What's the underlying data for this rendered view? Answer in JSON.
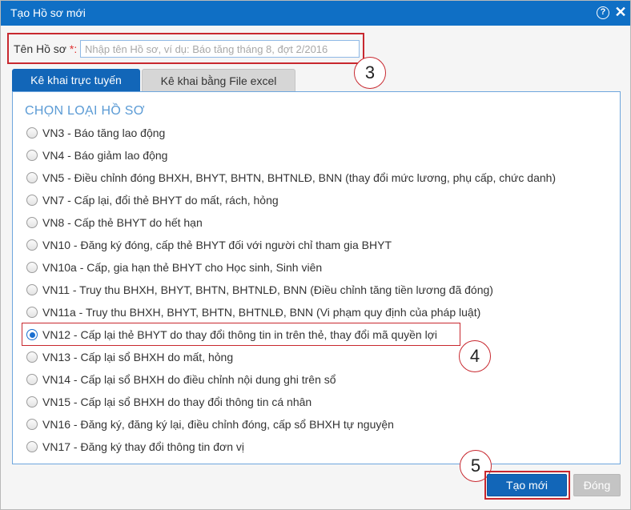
{
  "dialog": {
    "title": "Tạo Hồ sơ mới",
    "help_glyph": "?",
    "close_glyph": "✕"
  },
  "name_field": {
    "label": "Tên Hồ sơ ",
    "required_mark": "*:",
    "value": "",
    "placeholder": "Nhập tên Hồ sơ, ví dụ: Báo tăng tháng 8, đợt 2/2016"
  },
  "callouts": {
    "c3": "3",
    "c4": "4",
    "c5": "5"
  },
  "tabs": [
    {
      "label": "Kê khai trực tuyến",
      "active": true
    },
    {
      "label": "Kê khai bằng File excel",
      "active": false
    }
  ],
  "section_title": "CHỌN LOẠI HỒ SƠ",
  "options": [
    {
      "label": "VN3 - Báo tăng lao động",
      "checked": false
    },
    {
      "label": "VN4 - Báo giảm lao động",
      "checked": false
    },
    {
      "label": "VN5 - Điều chỉnh đóng BHXH, BHYT, BHTN, BHTNLĐ, BNN (thay đổi mức lương, phụ cấp, chức danh)",
      "checked": false
    },
    {
      "label": "VN7 - Cấp lại, đổi thẻ BHYT do mất, rách, hỏng",
      "checked": false
    },
    {
      "label": "VN8 - Cấp thẻ BHYT do hết hạn",
      "checked": false
    },
    {
      "label": "VN10 - Đăng ký đóng, cấp thẻ BHYT đối với người chỉ tham gia BHYT",
      "checked": false
    },
    {
      "label": "VN10a - Cấp, gia hạn thẻ BHYT cho Học sinh, Sinh viên",
      "checked": false
    },
    {
      "label": "VN11 - Truy thu BHXH, BHYT, BHTN, BHTNLĐ, BNN (Điều chỉnh tăng tiền lương đã đóng)",
      "checked": false
    },
    {
      "label": "VN11a - Truy thu BHXH, BHYT, BHTN, BHTNLĐ, BNN (Vi phạm quy định của pháp luật)",
      "checked": false
    },
    {
      "label": "VN12 - Cấp lại thẻ BHYT do thay đổi thông tin in trên thẻ, thay đổi mã quyền lợi",
      "checked": true
    },
    {
      "label": "VN13 - Cấp lại sổ BHXH do mất, hỏng",
      "checked": false
    },
    {
      "label": "VN14 - Cấp lại sổ BHXH do điều chỉnh nội dung ghi trên sổ",
      "checked": false
    },
    {
      "label": "VN15 - Cấp lại sổ BHXH do thay đổi thông tin cá nhân",
      "checked": false
    },
    {
      "label": "VN16 - Đăng ký, đăng ký lại, điều chỉnh đóng, cấp sổ BHXH tự nguyện",
      "checked": false
    },
    {
      "label": "VN17 - Đăng ký thay đổi thông tin đơn vị",
      "checked": false
    }
  ],
  "buttons": {
    "create": "Tạo mới",
    "close": "Đóng"
  },
  "colors": {
    "titlebar": "#0f6fc5",
    "primary": "#1266b8",
    "highlight": "#c8282f",
    "section_title": "#5b9bd5"
  }
}
